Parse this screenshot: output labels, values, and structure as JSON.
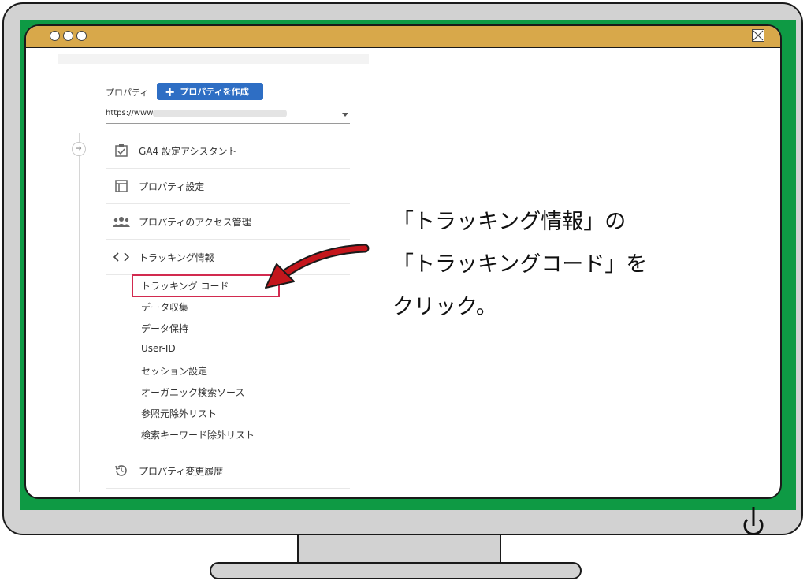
{
  "property": {
    "label": "プロパティ",
    "create_button": "プロパティを作成",
    "url_prefix": "https://www"
  },
  "menu": [
    {
      "icon": "checklist-icon",
      "label": "GA4 設定アシスタント"
    },
    {
      "icon": "layout-icon",
      "label": "プロパティ設定"
    },
    {
      "icon": "people-icon",
      "label": "プロパティのアクセス管理"
    },
    {
      "icon": "code-icon",
      "label": "トラッキング情報"
    }
  ],
  "tracking_submenu": [
    "トラッキング コード",
    "データ収集",
    "データ保持",
    "User-ID",
    "セッション設定",
    "オーガニック検索ソース",
    "参照元除外リスト",
    "検索キーワード除外リスト"
  ],
  "history": {
    "icon": "history-icon",
    "label": "プロパティ変更履歴"
  },
  "annotation": {
    "line1": "「トラッキング情報」の",
    "line2": "「トラッキングコード」を",
    "line3": "クリック。"
  },
  "colors": {
    "bezel": "#0e9a44",
    "titlebar": "#d8a84a",
    "button": "#2e6ec4",
    "highlight": "#d22a4f",
    "arrow": "#c4161c"
  }
}
